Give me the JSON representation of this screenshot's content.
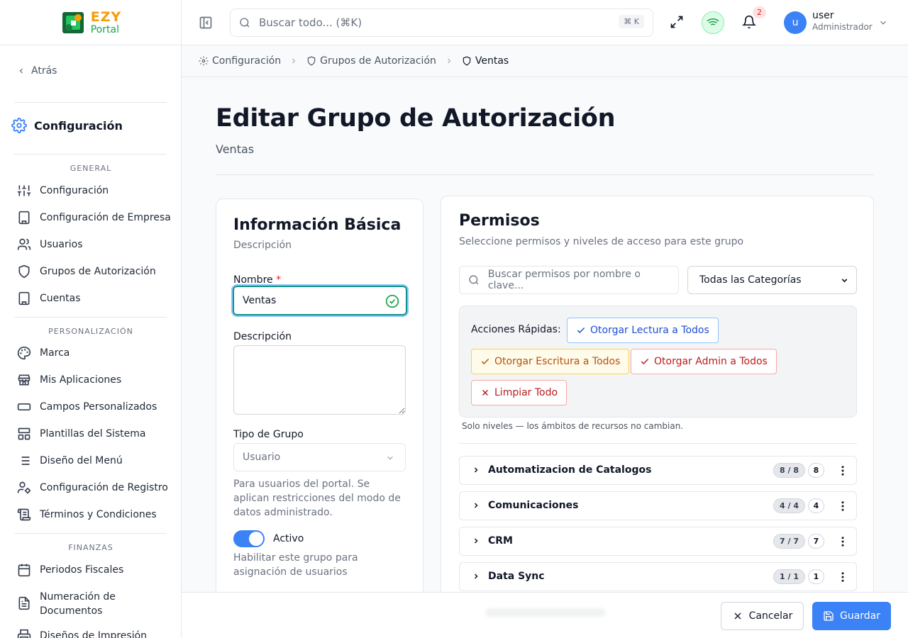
{
  "app": {
    "logo_top": "EZY",
    "logo_bottom": "Portal"
  },
  "sidebar": {
    "back_label": "Atrás",
    "title": "Configuración",
    "sections": [
      {
        "label": "GENERAL",
        "items": [
          {
            "label": "Configuración",
            "icon": "sliders-icon"
          },
          {
            "label": "Configuración de Empresa",
            "icon": "building-icon"
          },
          {
            "label": "Usuarios",
            "icon": "users-icon"
          },
          {
            "label": "Grupos de Autorización",
            "icon": "shield-icon"
          },
          {
            "label": "Cuentas",
            "icon": "building-icon"
          }
        ]
      },
      {
        "label": "PERSONALIZACIÓN",
        "items": [
          {
            "label": "Marca",
            "icon": "palette-icon"
          },
          {
            "label": "Mis Aplicaciones",
            "icon": "store-icon"
          },
          {
            "label": "Campos Personalizados",
            "icon": "input-icon"
          },
          {
            "label": "Plantillas del Sistema",
            "icon": "layout-icon"
          },
          {
            "label": "Diseño del Menú",
            "icon": "list-icon"
          },
          {
            "label": "Configuración de Registro",
            "icon": "user-cog-icon"
          },
          {
            "label": "Términos y Condiciones",
            "icon": "scroll-icon"
          }
        ]
      },
      {
        "label": "FINANZAS",
        "items": [
          {
            "label": "Periodos Fiscales",
            "icon": "calendar-icon"
          },
          {
            "label": "Numeración de Documentos",
            "icon": "file-text-icon"
          },
          {
            "label": "Diseños de Impresión",
            "icon": "printer-icon"
          }
        ]
      }
    ]
  },
  "topbar": {
    "search_placeholder": "Buscar todo... (⌘K)",
    "shortcut": "⌘ K",
    "notifications_count": "2",
    "user_initial": "u",
    "user_name": "user",
    "user_role": "Administrador"
  },
  "breadcrumb": [
    {
      "label": "Configuración",
      "icon": "gear-icon"
    },
    {
      "label": "Grupos de Autorización",
      "icon": "shield-icon"
    },
    {
      "label": "Ventas",
      "icon": "shield-icon"
    }
  ],
  "page": {
    "title": "Editar Grupo de Autorización",
    "subtitle": "Ventas"
  },
  "basic": {
    "title": "Información Básica",
    "description": "Descripción",
    "name_label": "Nombre",
    "name_required": "*",
    "name_value": "Ventas",
    "desc_label": "Descripción",
    "type_label": "Tipo de Grupo",
    "type_value": "Usuario",
    "type_help": "Para usuarios del portal. Se aplican restricciones del modo de datos administrado.",
    "active_label": "Activo",
    "active_on": true,
    "active_help": "Habilitar este grupo para asignación de usuarios"
  },
  "permissions": {
    "title": "Permisos",
    "description": "Seleccione permisos y niveles de acceso para este grupo",
    "search_placeholder": "Buscar permisos por nombre o clave...",
    "category_value": "Todas las Categorías",
    "quick_label": "Acciones Rápidas:",
    "quick_read": "Otorgar Lectura a Todos",
    "quick_write": "Otorgar Escritura a Todos",
    "quick_admin": "Otorgar Admin a Todos",
    "quick_clear": "Limpiar Todo",
    "note": "Solo niveles — los ámbitos de recursos no cambian.",
    "groups": [
      {
        "name": "Automatizacion de Catalogos",
        "count": "8 / 8",
        "total": "8"
      },
      {
        "name": "Comunicaciones",
        "count": "4 / 4",
        "total": "4"
      },
      {
        "name": "CRM",
        "count": "7 / 7",
        "total": "7"
      },
      {
        "name": "Data Sync",
        "count": "1 / 1",
        "total": "1"
      }
    ]
  },
  "footer": {
    "cancel_label": "Cancelar",
    "save_label": "Guardar"
  },
  "colors": {
    "primary": "#3b82f6",
    "success": "#16a34a",
    "warning": "#b45309",
    "danger": "#b91c1c",
    "logo_orange": "#f59e0b"
  }
}
